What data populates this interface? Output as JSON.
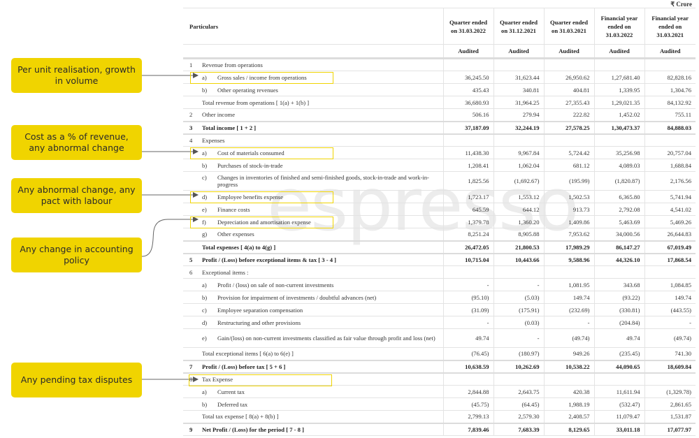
{
  "unit_label": "₹ Crore",
  "watermark": "espresso",
  "header": {
    "particulars": "Particulars",
    "columns": [
      "Quarter ended on 31.03.2022",
      "Quarter ended on 31.12.2021",
      "Quarter ended on 31.03.2021",
      "Financial year ended on 31.03.2022",
      "Financial year ended on 31.03.2021"
    ],
    "audit_status": [
      "Audited",
      "Audited",
      "Audited",
      "Audited",
      "Audited"
    ]
  },
  "callouts": [
    {
      "text": "Per unit realisation, growth in volume",
      "target": "Gross sales / income from operations"
    },
    {
      "text": "Cost as a % of revenue, any abnormal change",
      "target": "Cost of materials consumed"
    },
    {
      "text": "Any abnormal change, any pact with labour",
      "target": "Employee benefits expense"
    },
    {
      "text": "Any change in accounting policy",
      "target": "Depreciation and amortisation expense"
    },
    {
      "text": "Any pending tax disputes",
      "target": "Tax Expense"
    }
  ],
  "rows": [
    {
      "num": "1",
      "label": "Revenue from operations",
      "values": [
        "",
        "",
        "",
        "",
        ""
      ]
    },
    {
      "sub": "a)",
      "label": "Gross sales / income from operations",
      "values": [
        "36,245.50",
        "31,623.44",
        "26,950.62",
        "1,27,681.40",
        "82,828.16"
      ]
    },
    {
      "sub": "b)",
      "label": "Other operating revenues",
      "values": [
        "435.43",
        "340.81",
        "404.81",
        "1,339.95",
        "1,304.76"
      ]
    },
    {
      "label": "Total revenue from operations  [ 1(a) + 1(b) ]",
      "values": [
        "36,680.93",
        "31,964.25",
        "27,355.43",
        "1,29,021.35",
        "84,132.92"
      ]
    },
    {
      "num": "2",
      "label": "Other income",
      "values": [
        "506.16",
        "279.94",
        "222.82",
        "1,452.02",
        "755.11"
      ]
    },
    {
      "num": "3",
      "label": "Total income  [ 1 + 2 ]",
      "values": [
        "37,187.09",
        "32,244.19",
        "27,578.25",
        "1,30,473.37",
        "84,888.03"
      ]
    },
    {
      "num": "4",
      "label": "Expenses",
      "values": [
        "",
        "",
        "",
        "",
        ""
      ]
    },
    {
      "sub": "a)",
      "label": "Cost of materials consumed",
      "values": [
        "11,438.30",
        "9,967.84",
        "5,724.42",
        "35,256.98",
        "20,757.04"
      ]
    },
    {
      "sub": "b)",
      "label": "Purchases of stock-in-trade",
      "values": [
        "1,208.41",
        "1,062.04",
        "681.12",
        "4,089.03",
        "1,688.84"
      ]
    },
    {
      "sub": "c)",
      "label": "Changes in inventories of finished and semi-finished goods, stock-in-trade and work-in-progress",
      "values": [
        "1,825.56",
        "(1,692.67)",
        "(195.99)",
        "(1,820.87)",
        "2,176.56"
      ]
    },
    {
      "sub": "d)",
      "label": "Employee benefits expense",
      "values": [
        "1,723.17",
        "1,553.12",
        "1,502.53",
        "6,365.80",
        "5,741.94"
      ]
    },
    {
      "sub": "e)",
      "label": "Finance costs",
      "values": [
        "645.59",
        "644.12",
        "913.73",
        "2,792.08",
        "4,541.02"
      ]
    },
    {
      "sub": "f)",
      "label": "Depreciation and amortisation expense",
      "values": [
        "1,379.78",
        "1,360.20",
        "1,409.86",
        "5,463.69",
        "5,469.26"
      ]
    },
    {
      "sub": "g)",
      "label": "Other expenses",
      "values": [
        "8,251.24",
        "8,905.88",
        "7,953.62",
        "34,000.56",
        "26,644.83"
      ]
    },
    {
      "label": "Total expenses [ 4(a) to 4(g) ]",
      "values": [
        "26,472.05",
        "21,800.53",
        "17,989.29",
        "86,147.27",
        "67,019.49"
      ]
    },
    {
      "num": "5",
      "label": "Profit / (Loss) before exceptional items & tax [ 3 - 4 ]",
      "values": [
        "10,715.04",
        "10,443.66",
        "9,588.96",
        "44,326.10",
        "17,868.54"
      ]
    },
    {
      "num": "6",
      "label": "Exceptional items :",
      "values": [
        "",
        "",
        "",
        "",
        ""
      ]
    },
    {
      "sub": "a)",
      "label": "Profit / (loss) on sale of non-current investments",
      "values": [
        "-",
        "-",
        "1,081.95",
        "343.68",
        "1,084.85"
      ]
    },
    {
      "sub": "b)",
      "label": "Provision for impairment of investments / doubtful advances (net)",
      "values": [
        "(95.10)",
        "(5.03)",
        "149.74",
        "(93.22)",
        "149.74"
      ]
    },
    {
      "sub": "c)",
      "label": "Employee separation compensation",
      "values": [
        "(31.09)",
        "(175.91)",
        "(232.69)",
        "(330.81)",
        "(443.55)"
      ]
    },
    {
      "sub": "d)",
      "label": "Restructuring and other provisions",
      "values": [
        "-",
        "(0.03)",
        "-",
        "(204.84)",
        "-"
      ]
    },
    {
      "sub": "e)",
      "label": "Gain/(loss) on non-current investments classified as fair value through profit and loss (net)",
      "values": [
        "49.74",
        "-",
        "(49.74)",
        "49.74",
        "(49.74)"
      ]
    },
    {
      "label": "Total exceptional items [ 6(a) to 6(e) ]",
      "values": [
        "(76.45)",
        "(180.97)",
        "949.26",
        "(235.45)",
        "741.30"
      ]
    },
    {
      "num": "7",
      "label": "Profit / (Loss) before tax [ 5 + 6 ]",
      "values": [
        "10,638.59",
        "10,262.69",
        "10,538.22",
        "44,090.65",
        "18,609.84"
      ]
    },
    {
      "num": "8",
      "label": "Tax Expense",
      "values": [
        "",
        "",
        "",
        "",
        ""
      ]
    },
    {
      "sub": "a)",
      "label": "Current tax",
      "values": [
        "2,844.88",
        "2,643.75",
        "420.38",
        "11,611.94",
        "(1,329.78)"
      ]
    },
    {
      "sub": "b)",
      "label": "Deferred tax",
      "values": [
        "(45.75)",
        "(64.45)",
        "1,988.19",
        "(532.47)",
        "2,861.65"
      ]
    },
    {
      "label": "Total tax expense [ 8(a) + 8(b) ]",
      "values": [
        "2,799.13",
        "2,579.30",
        "2,408.57",
        "11,079.47",
        "1,531.87"
      ]
    },
    {
      "num": "9",
      "label": "Net Profit / (Loss) for the period  [ 7 - 8 ]",
      "values": [
        "7,839.46",
        "7,683.39",
        "8,129.65",
        "33,011.18",
        "17,077.97"
      ]
    }
  ]
}
